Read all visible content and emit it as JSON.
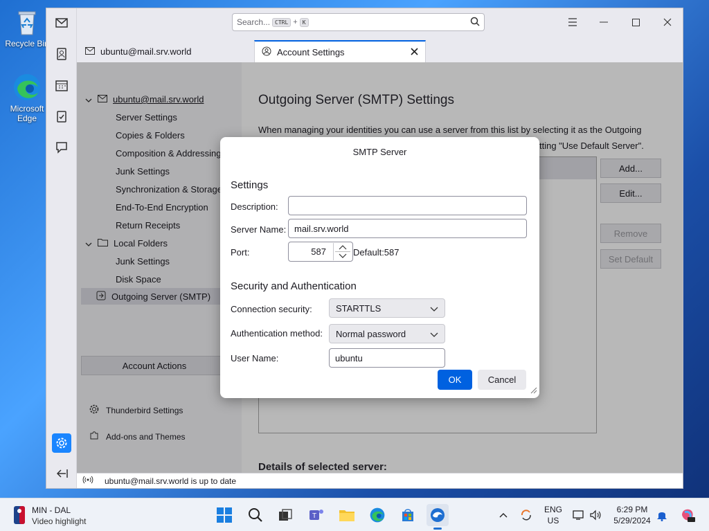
{
  "desktop": {
    "icons": [
      {
        "label": "Recycle Bin"
      },
      {
        "label": "Microsoft Edge"
      }
    ]
  },
  "thunderbird": {
    "search": {
      "placeholder": "Search...",
      "key1": "CTRL",
      "plus": "+",
      "key2": "K"
    },
    "tabs": [
      {
        "label": "ubuntu@mail.srv.world"
      },
      {
        "label": "Account Settings"
      }
    ],
    "tree": {
      "account": "ubuntu@mail.srv.world",
      "account_items": [
        "Server Settings",
        "Copies & Folders",
        "Composition & Addressing",
        "Junk Settings",
        "Synchronization & Storage",
        "End-To-End Encryption",
        "Return Receipts"
      ],
      "local_folders": "Local Folders",
      "local_items": [
        "Junk Settings",
        "Disk Space"
      ],
      "outgoing": "Outgoing Server (SMTP)"
    },
    "account_actions": "Account Actions",
    "footer_links": {
      "settings": "Thunderbird Settings",
      "addons": "Add-ons and Themes"
    },
    "smtp_page": {
      "title": "Outgoing Server (SMTP) Settings",
      "desc_line1": "When managing your identities you can use a server from this list by selecting it as the Outgoing",
      "desc_line2_tail": "tting \"Use Default Server\".",
      "buttons": {
        "add": "Add...",
        "edit": "Edit...",
        "remove": "Remove",
        "set_default": "Set Default"
      },
      "details_header": "Details of selected server:"
    },
    "status": "ubuntu@mail.srv.world is up to date"
  },
  "dialog": {
    "title": "SMTP Server",
    "settings_header": "Settings",
    "description_label": "Description:",
    "description_value": "",
    "server_name_label": "Server Name:",
    "server_name_value": "mail.srv.world",
    "port_label": "Port:",
    "port_value": "587",
    "port_default": "Default:587",
    "security_header": "Security and Authentication",
    "conn_security_label": "Connection security:",
    "conn_security_value": "STARTTLS",
    "auth_method_label": "Authentication method:",
    "auth_method_value": "Normal password",
    "username_label": "User Name:",
    "username_value": "ubuntu",
    "ok": "OK",
    "cancel": "Cancel"
  },
  "taskbar": {
    "widget": {
      "line1": "MIN - DAL",
      "line2": "Video highlight"
    },
    "lang": {
      "line1": "ENG",
      "line2": "US"
    },
    "time": "6:29 PM",
    "date": "5/29/2024"
  },
  "colors": {
    "accent": "#0061e0",
    "taskbar": "#eef2f8"
  }
}
